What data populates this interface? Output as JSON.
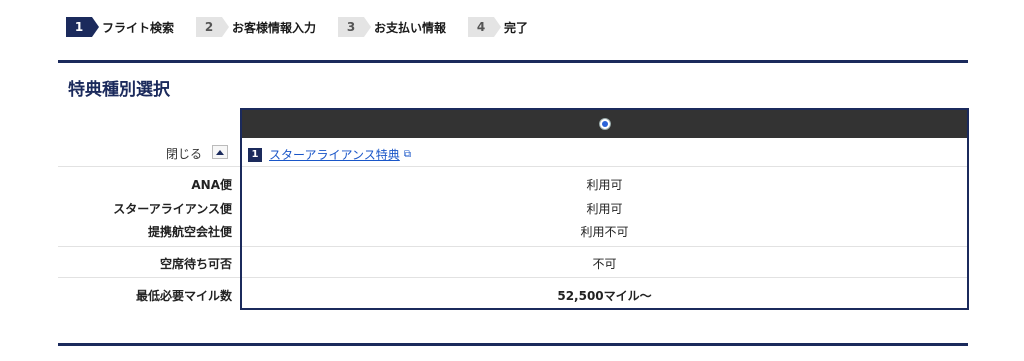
{
  "stepper": [
    {
      "num": "1",
      "label": "フライト検索",
      "active": true
    },
    {
      "num": "2",
      "label": "お客様情報入力",
      "active": false
    },
    {
      "num": "3",
      "label": "お支払い情報",
      "active": false
    },
    {
      "num": "4",
      "label": "完了",
      "active": false
    }
  ],
  "section": {
    "title": "特典種別選択"
  },
  "toggle": {
    "label": "閉じる"
  },
  "plan": {
    "number": "1",
    "name": "スターアライアンス特典",
    "selected": true,
    "external_link_icon": "external-link-icon"
  },
  "rows": {
    "ana": {
      "label": "ANA便",
      "value": "利用可"
    },
    "star_alliance": {
      "label": "スターアライアンス便",
      "value": "利用可"
    },
    "partner": {
      "label": "提携航空会社便",
      "value": "利用不可"
    },
    "waitlist": {
      "label": "空席待ち可否",
      "value": "不可"
    },
    "min_miles": {
      "label": "最低必要マイル数",
      "value": "52,500マイル〜"
    }
  },
  "colors": {
    "brand_navy": "#1b2a5c",
    "header_dark": "#333333",
    "link_blue": "#1a56c8",
    "radio_blue": "#2b63d9"
  }
}
